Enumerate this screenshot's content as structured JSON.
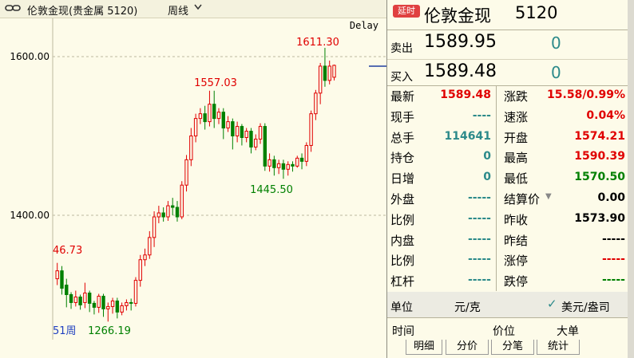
{
  "title": "伦敦金现(贵金属 5120)",
  "period": "周线",
  "chart": {
    "delay": "Delay",
    "y_ticks": [
      "1600.00",
      "1400.00"
    ],
    "annotations": {
      "peak": "1611.30",
      "high1": "1557.03",
      "trough1": "1445.50",
      "left_high": "46.73",
      "low": "1266.19",
      "week_label": "51周"
    }
  },
  "chart_data": {
    "type": "candlestick",
    "y_ticks": [
      1600,
      1400
    ],
    "annotations": [
      {
        "label": "1611.30",
        "value": 1611.3
      },
      {
        "label": "1557.03",
        "value": 1557.03
      },
      {
        "label": "1445.50",
        "value": 1445.5
      },
      {
        "label": "46.73",
        "value": 1346.73
      },
      {
        "label": "1266.19",
        "value": 1266.19
      }
    ],
    "candles": [
      [
        1320,
        1330,
        1312,
        1340
      ],
      [
        1330,
        1308,
        1300,
        1336
      ],
      [
        1312,
        1300,
        1284,
        1320
      ],
      [
        1300,
        1290,
        1282,
        1303
      ],
      [
        1290,
        1297,
        1285,
        1305
      ],
      [
        1297,
        1287,
        1281,
        1300
      ],
      [
        1290,
        1302,
        1283,
        1315
      ],
      [
        1302,
        1289,
        1278,
        1305
      ],
      [
        1289,
        1284,
        1275,
        1292
      ],
      [
        1284,
        1298,
        1277,
        1301
      ],
      [
        1298,
        1282,
        1272,
        1301
      ],
      [
        1282,
        1285,
        1266,
        1290
      ],
      [
        1285,
        1292,
        1276,
        1296
      ],
      [
        1292,
        1278,
        1270,
        1296
      ],
      [
        1278,
        1286,
        1274,
        1290
      ],
      [
        1286,
        1290,
        1280,
        1294
      ],
      [
        1290,
        1289,
        1280,
        1295
      ],
      [
        1289,
        1318,
        1285,
        1322
      ],
      [
        1318,
        1344,
        1310,
        1350
      ],
      [
        1344,
        1350,
        1336,
        1358
      ],
      [
        1350,
        1372,
        1345,
        1380
      ],
      [
        1372,
        1398,
        1360,
        1405
      ],
      [
        1398,
        1403,
        1390,
        1412
      ],
      [
        1403,
        1398,
        1392,
        1410
      ],
      [
        1398,
        1412,
        1393,
        1418
      ],
      [
        1412,
        1410,
        1400,
        1422
      ],
      [
        1410,
        1398,
        1392,
        1418
      ],
      [
        1398,
        1438,
        1395,
        1443
      ],
      [
        1438,
        1470,
        1430,
        1476
      ],
      [
        1470,
        1500,
        1462,
        1510
      ],
      [
        1500,
        1522,
        1492,
        1528
      ],
      [
        1522,
        1528,
        1515,
        1535
      ],
      [
        1528,
        1518,
        1508,
        1538
      ],
      [
        1518,
        1540,
        1512,
        1557
      ],
      [
        1540,
        1522,
        1510,
        1557
      ],
      [
        1522,
        1530,
        1515,
        1535
      ],
      [
        1530,
        1510,
        1496,
        1535
      ],
      [
        1510,
        1518,
        1505,
        1525
      ],
      [
        1518,
        1500,
        1483,
        1522
      ],
      [
        1500,
        1512,
        1492,
        1518
      ],
      [
        1512,
        1498,
        1488,
        1515
      ],
      [
        1498,
        1506,
        1492,
        1510
      ],
      [
        1506,
        1486,
        1478,
        1510
      ],
      [
        1486,
        1496,
        1482,
        1502
      ],
      [
        1496,
        1512,
        1490,
        1516
      ],
      [
        1512,
        1462,
        1456,
        1516
      ],
      [
        1462,
        1470,
        1455,
        1478
      ],
      [
        1470,
        1460,
        1450,
        1475
      ],
      [
        1460,
        1465,
        1452,
        1470
      ],
      [
        1465,
        1458,
        1446,
        1470
      ],
      [
        1458,
        1464,
        1450,
        1468
      ],
      [
        1464,
        1462,
        1455,
        1468
      ],
      [
        1462,
        1472,
        1460,
        1475
      ],
      [
        1472,
        1468,
        1458,
        1478
      ],
      [
        1468,
        1488,
        1462,
        1492
      ],
      [
        1488,
        1528,
        1480,
        1532
      ],
      [
        1528,
        1554,
        1520,
        1558
      ],
      [
        1554,
        1588,
        1540,
        1592
      ],
      [
        1588,
        1570,
        1562,
        1611
      ],
      [
        1570,
        1588,
        1565,
        1595
      ],
      [
        1574,
        1589,
        1570,
        1590
      ]
    ]
  },
  "quote": {
    "badge": "延时",
    "name": "伦敦金现",
    "code": "5120",
    "sell_label": "卖出",
    "sell_price": "1589.95",
    "sell_vol": "0",
    "buy_label": "买入",
    "buy_price": "1589.48",
    "buy_vol": "0",
    "left": [
      {
        "label": "最新",
        "value": "1589.48"
      },
      {
        "label": "现手",
        "value": "----"
      },
      {
        "label": "总手",
        "value": "114641"
      },
      {
        "label": "持仓",
        "value": "0"
      },
      {
        "label": "日增",
        "value": "0"
      },
      {
        "label": "外盘",
        "value": "-----"
      },
      {
        "label": "比例",
        "value": "-----"
      },
      {
        "label": "内盘",
        "value": "-----"
      },
      {
        "label": "比例",
        "value": "-----"
      },
      {
        "label": "杠杆",
        "value": "-----"
      }
    ],
    "right": [
      {
        "label": "涨跌",
        "value": "15.58/0.99%"
      },
      {
        "label": "速涨",
        "value": "0.04%"
      },
      {
        "label": "开盘",
        "value": "1574.21"
      },
      {
        "label": "最高",
        "value": "1590.39"
      },
      {
        "label": "最低",
        "value": "1570.50"
      },
      {
        "label": "结算价",
        "value": "0.00"
      },
      {
        "label": "昨收",
        "value": "1573.90"
      },
      {
        "label": "昨结",
        "value": "-----"
      },
      {
        "label": "涨停",
        "value": "-----"
      },
      {
        "label": "跌停",
        "value": "-----"
      }
    ],
    "unit_label": "单位",
    "unit_value": "元/克",
    "unit_alt": "美元/盎司",
    "trade_headers": [
      "时间",
      "价位",
      "大单"
    ],
    "tabs": [
      "明细",
      "分价",
      "分笔",
      "统计"
    ]
  },
  "colors": {
    "up": "#e00000",
    "down": "#008000",
    "neutral": "#2c8a8a",
    "bg": "#fdfbe9"
  }
}
